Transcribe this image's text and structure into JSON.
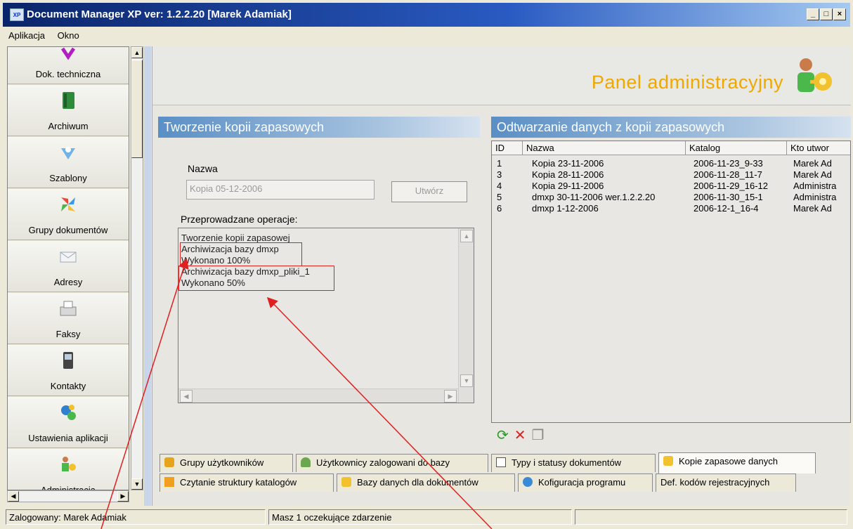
{
  "window": {
    "title": "Document Manager XP ver: 1.2.2.20  [Marek Adamiak]",
    "icon_text": "XP",
    "controls": [
      "_",
      "□",
      "×"
    ]
  },
  "menu": [
    "Aplikacja",
    "Okno"
  ],
  "sidebar": {
    "items": [
      {
        "label": "Dok. techniczna",
        "icon": "ribbon-icon"
      },
      {
        "label": "Archiwum",
        "icon": "book-icon"
      },
      {
        "label": "Szablony",
        "icon": "template-icon"
      },
      {
        "label": "Grupy dokumentów",
        "icon": "pinwheel-icon"
      },
      {
        "label": "Adresy",
        "icon": "envelope-icon"
      },
      {
        "label": "Faksy",
        "icon": "fax-icon"
      },
      {
        "label": "Kontakty",
        "icon": "phone-icon"
      },
      {
        "label": "Ustawienia aplikacji",
        "icon": "gears-icon"
      },
      {
        "label": "Administracja",
        "icon": "user-key-icon"
      }
    ]
  },
  "header": {
    "title": "Panel administracyjny"
  },
  "backup": {
    "section_title": "Tworzenie kopii zapasowych",
    "name_label": "Nazwa",
    "name_value": "Kopia 05-12-2006",
    "create_button": "Utwórz",
    "operations_label": "Przeprowadzane operacje:",
    "operations": [
      "Tworzenie kopii zapasowej",
      "Archiwizacja bazy dmxp",
      "Wykonano 100%",
      "Archiwizacja bazy dmxp_pliki_1",
      "Wykonano 50%"
    ]
  },
  "restore": {
    "section_title": "Odtwarzanie danych z kopii zapasowych",
    "columns": [
      "ID",
      "Nazwa",
      "Katalog",
      "Kto utwor"
    ],
    "rows": [
      [
        "1",
        "Kopia 23-11-2006",
        "2006-11-23_9-33",
        "Marek Ad"
      ],
      [
        "3",
        "Kopia 28-11-2006",
        "2006-11-28_11-7",
        "Marek Ad"
      ],
      [
        "4",
        "Kopia 29-11-2006",
        "2006-11-29_16-12",
        "Administra"
      ],
      [
        "5",
        "dmxp 30-11-2006 wer.1.2.2.20",
        "2006-11-30_15-1",
        "Administra"
      ],
      [
        "6",
        "dmxp 1-12-2006",
        "2006-12-1_16-4",
        "Marek Ad"
      ]
    ],
    "toolbar": [
      {
        "icon": "refresh-icon",
        "glyph": "⟳",
        "color": "#2a9a2a"
      },
      {
        "icon": "delete-icon",
        "glyph": "✕",
        "color": "#e02020"
      },
      {
        "icon": "copy-icon",
        "glyph": "❐",
        "color": "#888888"
      }
    ]
  },
  "tabs": {
    "row1": [
      {
        "label": "Grupy użytkowników",
        "icon": "users-group-icon",
        "color": "#e6a41c"
      },
      {
        "label": "Użytkownicy zalogowani do bazy",
        "icon": "user-icon",
        "color": "#6aa84f"
      },
      {
        "label": "Typy i statusy dokumentów",
        "icon": "document-icon",
        "color": "#ffffff"
      },
      {
        "label": "Kopie zapasowe danych",
        "icon": "database-icon",
        "color": "#f2c12e",
        "active": true
      }
    ],
    "row2": [
      {
        "label": "Czytanie struktury katalogów",
        "icon": "folder-icon",
        "color": "#f0a01e"
      },
      {
        "label": "Bazy danych dla dokumentów",
        "icon": "database-icon",
        "color": "#f2c12e"
      },
      {
        "label": "Kofiguracja programu",
        "icon": "gear-icon",
        "color": "#3a8ad8"
      },
      {
        "label": "Def. kodów rejestracyjnych",
        "icon": "",
        "color": ""
      }
    ]
  },
  "status": {
    "user": "Zalogowany: Marek Adamiak",
    "events": "Masz 1 oczekujące zdarzenie",
    "empty": ""
  },
  "colors": {
    "accent_title": "#f0a800",
    "section_header": "#5a8fc5",
    "annotation": "#e02020"
  }
}
